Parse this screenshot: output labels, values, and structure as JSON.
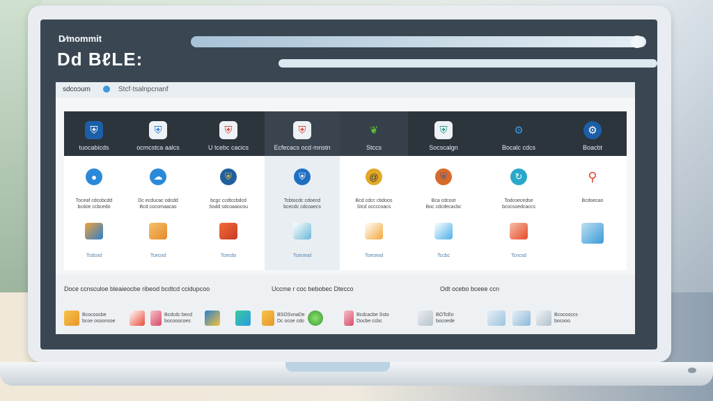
{
  "header": {
    "brand_small": "D⁄mommit",
    "brand_big": "Dd BℓLE:"
  },
  "window": {
    "tab_label": "sdcoɔum",
    "address": "Stcf·tsalnpcnanf"
  },
  "columns": [
    {
      "label": "tuocabicds",
      "sub1": "Toceaf cdcobcdd\nbcdoe ccbcedo",
      "sub2": "Tcdcod",
      "icon": "shield-icon",
      "icon2": "folder-icon"
    },
    {
      "label": "ocmcstca aalcs",
      "sub1": "Dc ecducac odcdd\nBcd cocomaacas",
      "sub2": "Tcecod",
      "icon": "shield-icon",
      "icon2": "box-icon"
    },
    {
      "label": "U tcebc cacics",
      "sub1": "bcgc ccdtccbdcd\nSodd sdcoaaocou",
      "sub2": "Tcecdo",
      "icon": "shield-icon",
      "icon2": "box-icon"
    },
    {
      "label": "Ecfecacs ocd·mnstn",
      "sub1": "Tcbtocdc cdoecd\nbcecdc cdcoaecs",
      "sub2": "Tceceod",
      "icon": "shield-icon",
      "icon2": "document-icon"
    },
    {
      "label": "Stccs",
      "sub1": "Bcd cdcc cbdoos\nStcd occccoacs",
      "sub2": "Tceceod",
      "icon": "leaf-icon",
      "icon2": "document-icon"
    },
    {
      "label": "Socscalgn",
      "sub1": "Bca cdcoot\nBoc cdcdecacbc",
      "sub2": "Tccbc",
      "icon": "shield-icon",
      "icon2": "document-icon"
    },
    {
      "label": "Bocalc cdcs",
      "sub1": "Todcoecedse\nbcocsoedcaccs",
      "sub2": "Tcncsd",
      "icon": "gear-icon",
      "icon2": "box-icon"
    },
    {
      "label": "Boacbt",
      "sub1": "Bcdoecan",
      "sub2": "",
      "icon": "gear-icon",
      "icon2": "folder-icon"
    }
  ],
  "bottom": {
    "titles": [
      "Doce ccnsculoe bleaieocbe ribeod bcdtcd ccidupcoo",
      "Uccme r coc bebobec Dtecco",
      "Odt ocebo bceee ccn"
    ],
    "items": [
      {
        "label": "Bcocoocbe\nbcoe osoonsoe"
      },
      {
        "label": "Bcdcdc becd\nbocooocoes"
      },
      {
        "label": "BSOSvnaDe\nDc ocoe cdo"
      },
      {
        "label": "Bcdcacbe Ssto\nDocbe ccbc"
      },
      {
        "label": "BOTcEo\nbocoede"
      },
      {
        "label": "Bcocooccs\nbocooo"
      }
    ]
  },
  "colors": {
    "screen": "#3a4753",
    "header_dark": "#2c343c",
    "accent": "#3a9ae0"
  }
}
